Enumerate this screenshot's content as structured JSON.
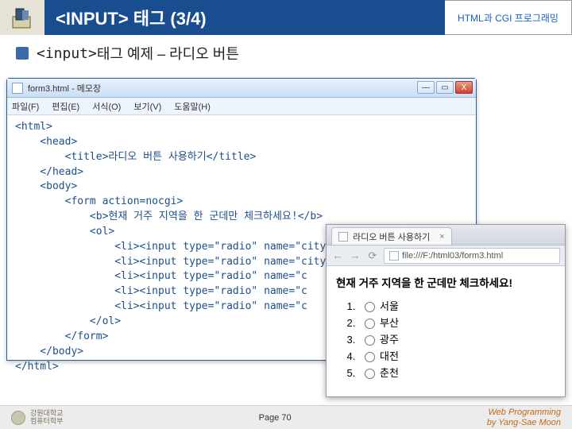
{
  "header": {
    "title": "<INPUT> 태그 (3/4)",
    "subtitle": "HTML과 CGI 프로그래밍"
  },
  "section": {
    "mono": "<input>",
    "rest": " 태그 예제 – 라디오 버튼"
  },
  "editor": {
    "titlebar": "form3.html - 메모장",
    "menu": [
      "파일(F)",
      "편집(E)",
      "서식(O)",
      "보기(V)",
      "도움말(H)"
    ],
    "ctrls": {
      "min": "—",
      "max": "▭",
      "close": "X"
    },
    "code": "<html>\n    <head>\n        <title>라디오 버튼 사용하기</title>\n    </head>\n    <body>\n        <form action=nocgi>\n            <b>현재 거주 지역을 한 군데만 체크하세요!</b>\n            <ol>\n                <li><input type=\"radio\" name=\"city\" value=\"서울\">서울\n                <li><input type=\"radio\" name=\"city\" value=\"부산\">부산\n                <li><input type=\"radio\" name=\"c\n                <li><input type=\"radio\" name=\"c\n                <li><input type=\"radio\" name=\"c\n            </ol>\n        </form>\n    </body>\n</html>"
  },
  "browser": {
    "tab_title": "라디오 버튼 사용하기",
    "url": "file:///F:/html03/form3.html",
    "prompt": "현재 거주 지역을 한 군데만 체크하세요!",
    "items": [
      "서울",
      "부산",
      "광주",
      "대전",
      "춘천"
    ],
    "nav": {
      "back": "←",
      "fwd": "→",
      "reload": "⟳"
    }
  },
  "footer": {
    "uni": "강원대학교\n컴퓨터학부",
    "page": "Page 70",
    "credit1": "Web Programming",
    "credit2": "by Yang-Sae Moon"
  }
}
